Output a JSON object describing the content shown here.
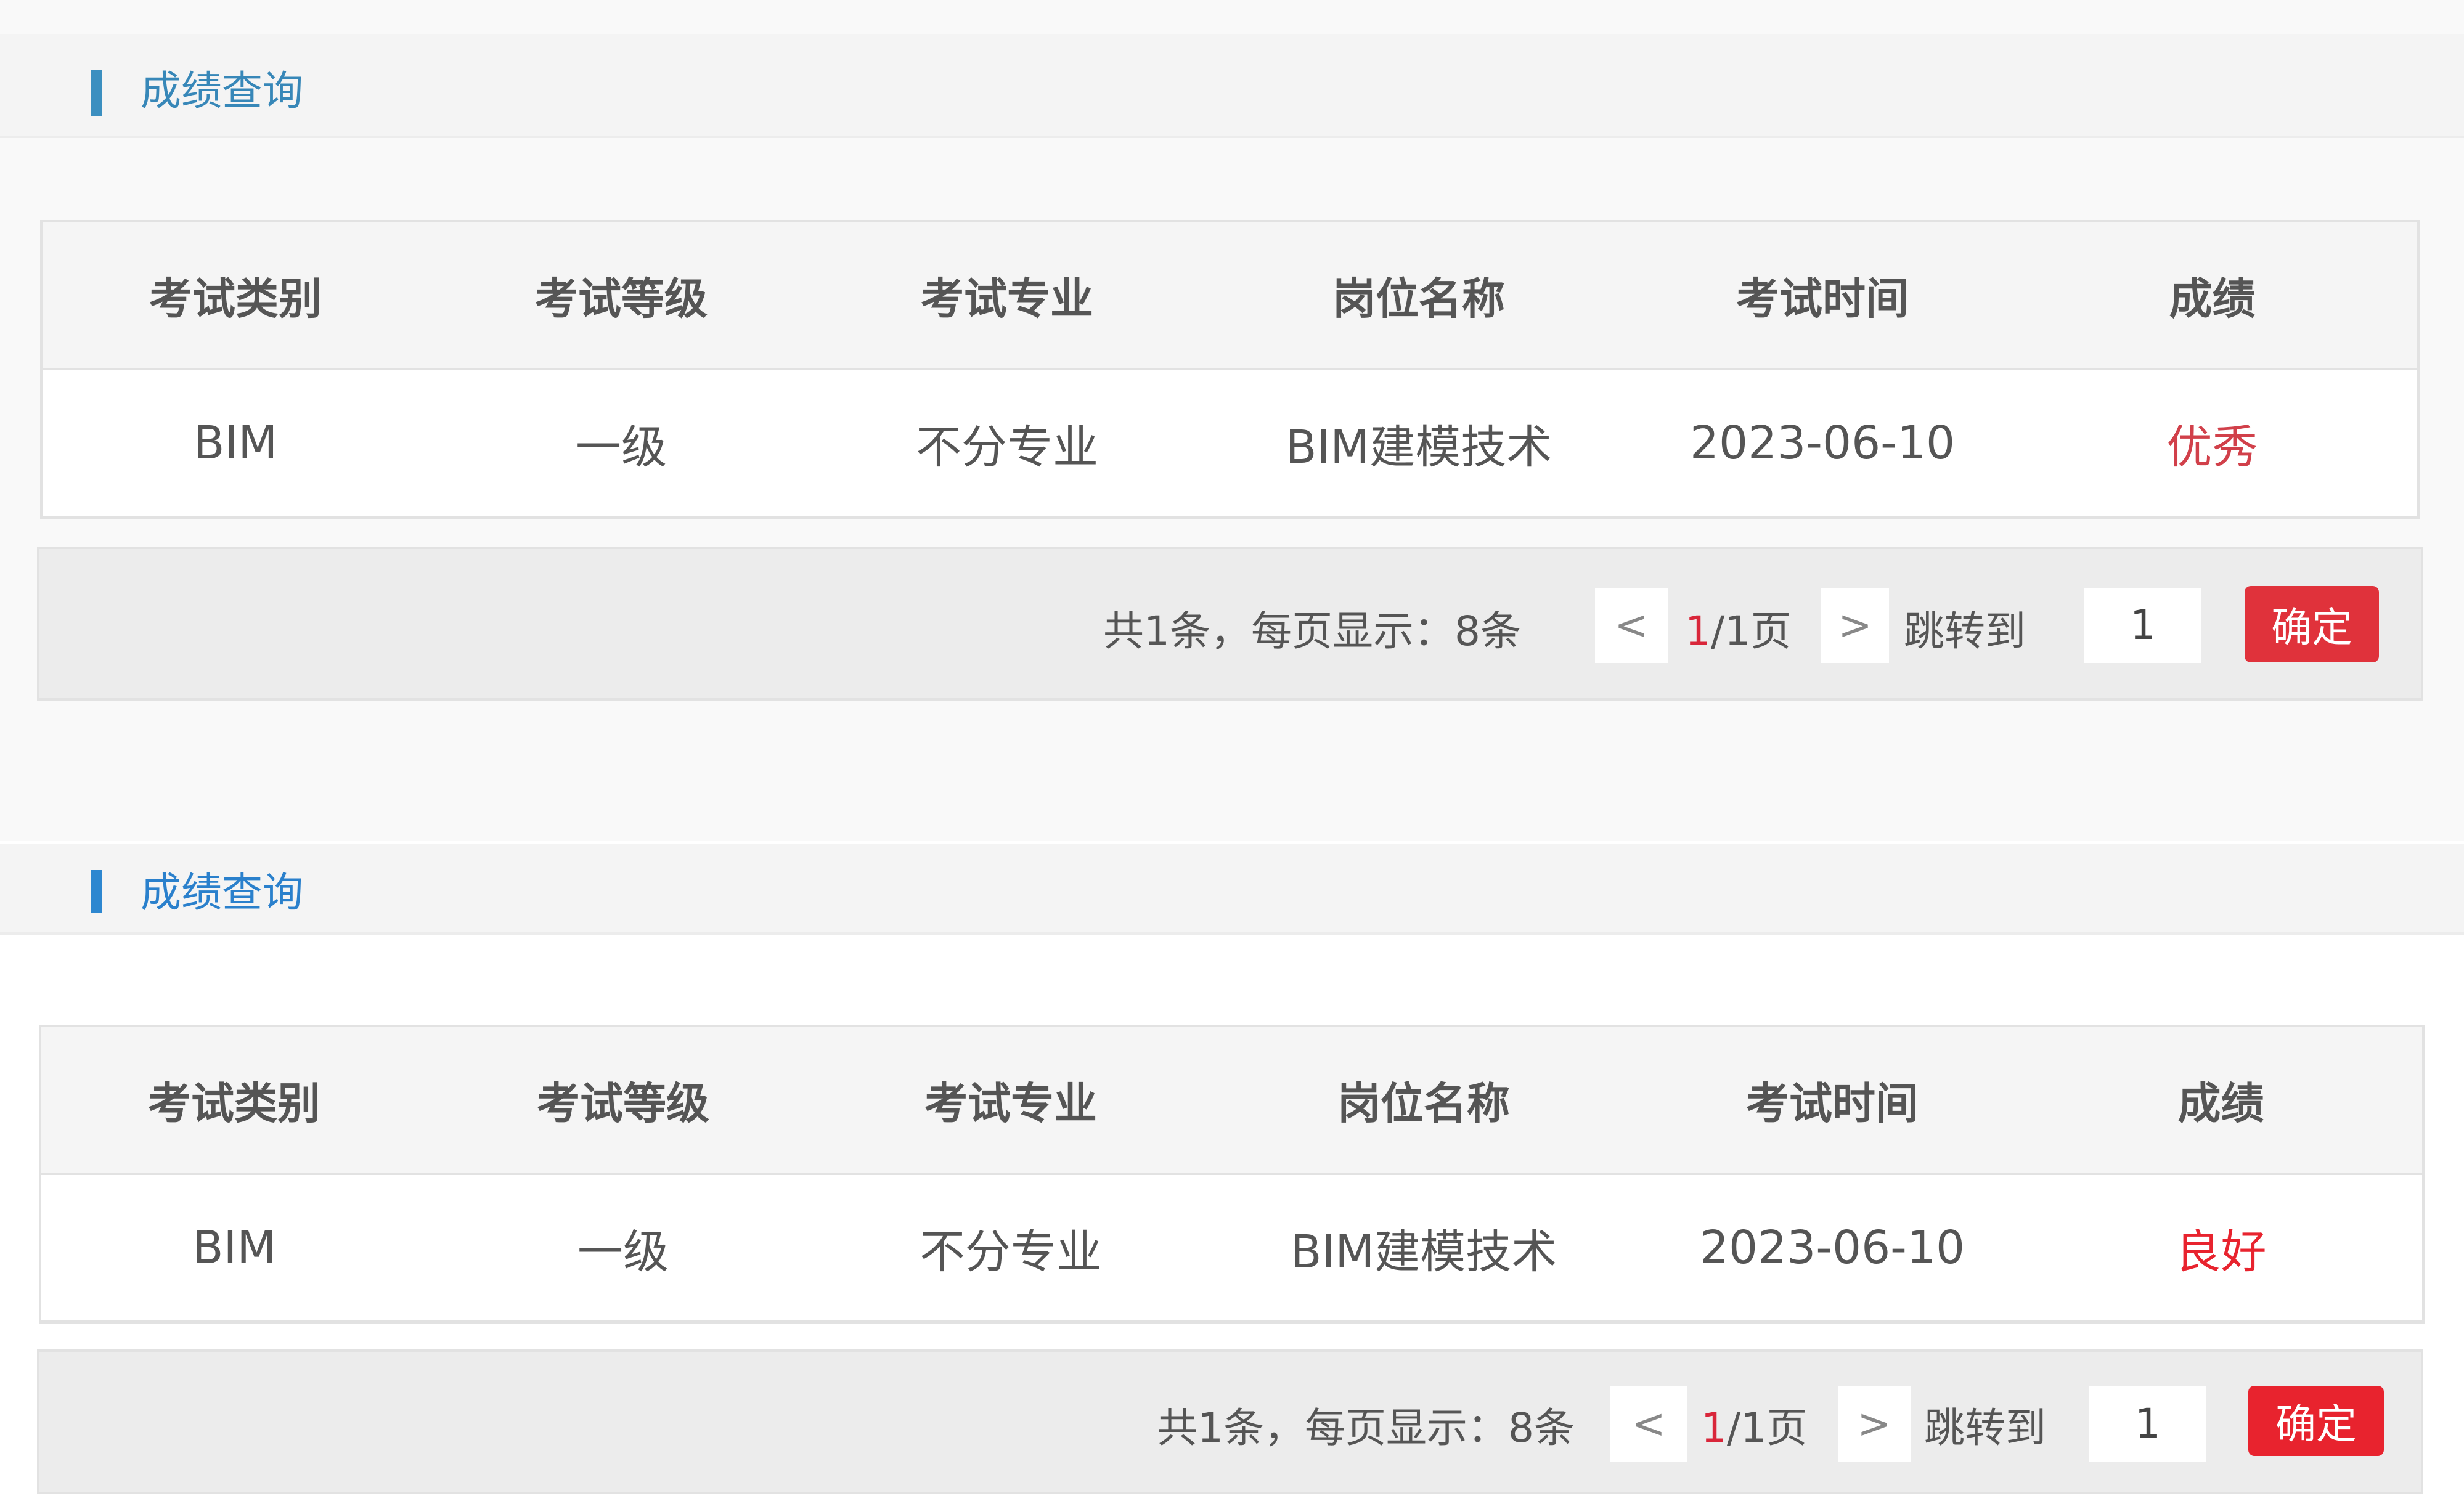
{
  "panels": [
    {
      "section_title": "成绩查询",
      "table": {
        "headers": [
          "考试类别",
          "考试等级",
          "考试专业",
          "岗位名称",
          "考试时间",
          "成绩"
        ],
        "rows": [
          [
            "BIM",
            "一级",
            "不分专业",
            "BIM建模技术",
            "2023-06-10",
            "优秀"
          ]
        ]
      },
      "score_color": "#d1404a",
      "accent_color": "#3b8fc0",
      "pager": {
        "summary": "共1条，每页显示：8条",
        "prev": "<",
        "current_page": "1",
        "page_suffix": "/1页",
        "next": ">",
        "jump_label": "跳转到",
        "jump_value": "1",
        "confirm": "确定",
        "confirm_color": "#e0323b"
      }
    },
    {
      "section_title": "成绩查询",
      "table": {
        "headers": [
          "考试类别",
          "考试等级",
          "考试专业",
          "岗位名称",
          "考试时间",
          "成绩"
        ],
        "rows": [
          [
            "BIM",
            "一级",
            "不分专业",
            "BIM建模技术",
            "2023-06-10",
            "良好"
          ]
        ]
      },
      "score_color": "#e8232e",
      "accent_color": "#2d87d0",
      "pager": {
        "summary": "共1条，每页显示：8条",
        "prev": "<",
        "current_page": "1",
        "page_suffix": "/1页",
        "next": ">",
        "jump_label": "跳转到",
        "jump_value": "1",
        "confirm": "确定",
        "confirm_color": "#e8232e"
      }
    }
  ]
}
